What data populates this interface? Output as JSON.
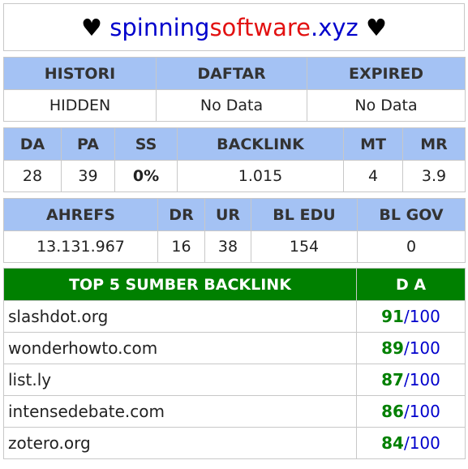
{
  "title": {
    "left_heart": "♥",
    "part1": "spinning",
    "part2": "software",
    "part3": ".xyz",
    "right_heart": "♥"
  },
  "domain_info": {
    "headers": [
      "HISTORI",
      "DAFTAR",
      "EXPIRED"
    ],
    "values": [
      "HIDDEN",
      "No Data",
      "No Data"
    ]
  },
  "metrics": {
    "headers": [
      "DA",
      "PA",
      "SS",
      "BACKLINK",
      "MT",
      "MR"
    ],
    "values": [
      "28",
      "39",
      "0%",
      "1.015",
      "4",
      "3.9"
    ]
  },
  "ahrefs": {
    "headers": [
      "AHREFS",
      "DR",
      "UR",
      "BL EDU",
      "BL GOV"
    ],
    "values": [
      "13.131.967",
      "16",
      "38",
      "154",
      "0"
    ]
  },
  "top_backlinks": {
    "header_source": "TOP 5 SUMBER BACKLINK",
    "header_da": "D A",
    "slash": "/",
    "rows": [
      {
        "domain": "slashdot.org",
        "score": "91",
        "max": "100"
      },
      {
        "domain": "wonderhowto.com",
        "score": "89",
        "max": "100"
      },
      {
        "domain": "list.ly",
        "score": "87",
        "max": "100"
      },
      {
        "domain": "intensedebate.com",
        "score": "86",
        "max": "100"
      },
      {
        "domain": "zotero.org",
        "score": "84",
        "max": "100"
      }
    ]
  },
  "colors": {
    "header_bg": "#a4c2f4",
    "top_header_bg": "#008000",
    "score": "#008000",
    "max": "#0000cc",
    "ss": "#5cd65c"
  }
}
